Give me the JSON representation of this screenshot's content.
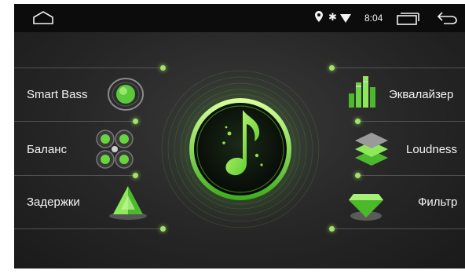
{
  "status_bar": {
    "time": "8:04",
    "icons": [
      "home-icon",
      "location-icon",
      "bluetooth-icon",
      "wifi-icon",
      "recent-apps-icon",
      "back-icon"
    ]
  },
  "menu": {
    "left": [
      {
        "label": "Smart Bass",
        "icon": "smart-bass-icon"
      },
      {
        "label": "Баланс",
        "icon": "balance-icon"
      },
      {
        "label": "Задержки",
        "icon": "delay-icon"
      }
    ],
    "right": [
      {
        "label": "Эквалайзер",
        "icon": "equalizer-icon"
      },
      {
        "label": "Loudness",
        "icon": "loudness-icon"
      },
      {
        "label": "Фильтр",
        "icon": "filter-icon"
      }
    ]
  },
  "center": {
    "icon": "music-note-icon"
  },
  "colors": {
    "accent": "#7ee24a",
    "accent_dark": "#2f8a1e",
    "bar": "#0c0c0c",
    "background": "#2a2a2a"
  }
}
